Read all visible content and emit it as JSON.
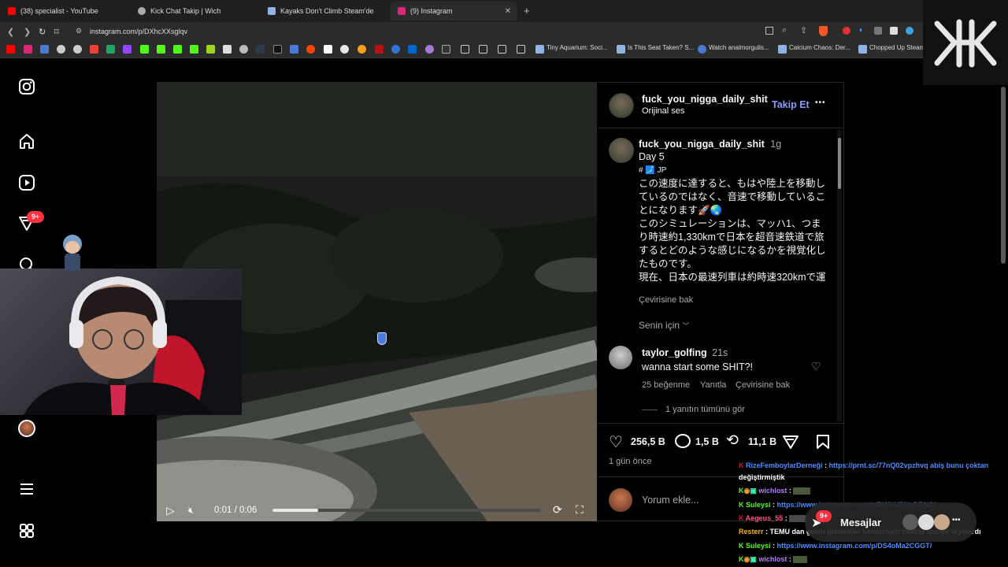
{
  "browser": {
    "tabs": [
      {
        "title": "(38) specialist - YouTube",
        "color": "#ff0000",
        "active": false
      },
      {
        "title": "Kick Chat Takip | Wich",
        "color": "#aaaaaa",
        "active": false
      },
      {
        "title": "Kayaks Don't Climb Steam'de",
        "color": "#8fb4e3",
        "active": false
      },
      {
        "title": "(9) Instagram",
        "color": "#d62976",
        "active": true
      }
    ],
    "new_tab": "+",
    "url": "instagram.com/p/DXhcXXsglqv",
    "bookmarks_text": [
      "Tiny Aquarium: Soci...",
      "Is This Seat Taken? S...",
      "Watch analmorgulis...",
      "Calcium Chaos: Der...",
      "Chopped Up Steam"
    ]
  },
  "sidebar": {
    "badge": "9+"
  },
  "video": {
    "time": "0:01 / 0:06",
    "progress": 0.17
  },
  "post": {
    "author": "fuck_you_nigga_daily_shit",
    "audio": "Orijinal ses",
    "follow": "Takip Et",
    "more": "•••",
    "caption_author": "fuck_you_nigga_daily_shit",
    "caption_age": "1g",
    "caption_day": "Day 5",
    "caption_tags": "# 🗾 JP",
    "caption_body": "この速度に達すると、もはや陸上を移動しているのではなく、音速で移動していることになります🚀🌏\nこのシミュレーションは、マッハ1、つまり時速約1,330kmで日本を超音速鉄道で旅するとどのような感じになるかを視覚化したものです。\n現在、日本の最速列車は約時速320kmで運",
    "translate": "Çevirisine bak",
    "for_you": "Senin için",
    "comment": {
      "author": "taylor_golfing",
      "age": "21s",
      "text": "wanna start some SHIT?!",
      "likes": "25 beğenme",
      "reply": "Yanıtla",
      "translate": "Çevirisine bak",
      "view_replies": "1 yanıtın tümünü gör"
    },
    "likes": "256,5 B",
    "comments": "1,5 B",
    "reposts": "11,1 B",
    "posted": "1 gün önce",
    "add_comment_placeholder": "Yorum ekle..."
  },
  "messages": {
    "label": "Mesajlar",
    "badge": "9+"
  },
  "chat": [
    {
      "user": "RizeFemboylarDerneği",
      "sep": " : ",
      "text": "https://prnt.sc/77nQ02vpzhvq abiş bunu çoktan",
      "ucolor": "#4f8cff"
    },
    {
      "user": "",
      "sep": "",
      "text": "değiştirmiştik",
      "ucolor": "#ffffff"
    },
    {
      "user": "wichlost",
      "sep": " : ",
      "text": "",
      "ucolor": "#b67cff"
    },
    {
      "user": "Suleysi",
      "sep": " : ",
      "text": "https://www.instagram.com/p/DWXUBUsDBNC/",
      "ucolor": "#53fc18"
    },
    {
      "user": "Aegeus_55",
      "sep": " : ",
      "text": "",
      "ucolor": "#ff4f8b"
    },
    {
      "user": "Resterr",
      "sep": " : ",
      "text": "TEMU dan gelen gümlekler kanserojen madde içeriyo diyolardı",
      "ucolor": "#ffb000"
    },
    {
      "user": "Suleysi",
      "sep": " : ",
      "text": "https://www.instagram.com/p/DS4oMa2CGGT/",
      "ucolor": "#53fc18"
    },
    {
      "user": "wichlost",
      "sep": " : ",
      "text": "",
      "ucolor": "#b67cff"
    }
  ]
}
